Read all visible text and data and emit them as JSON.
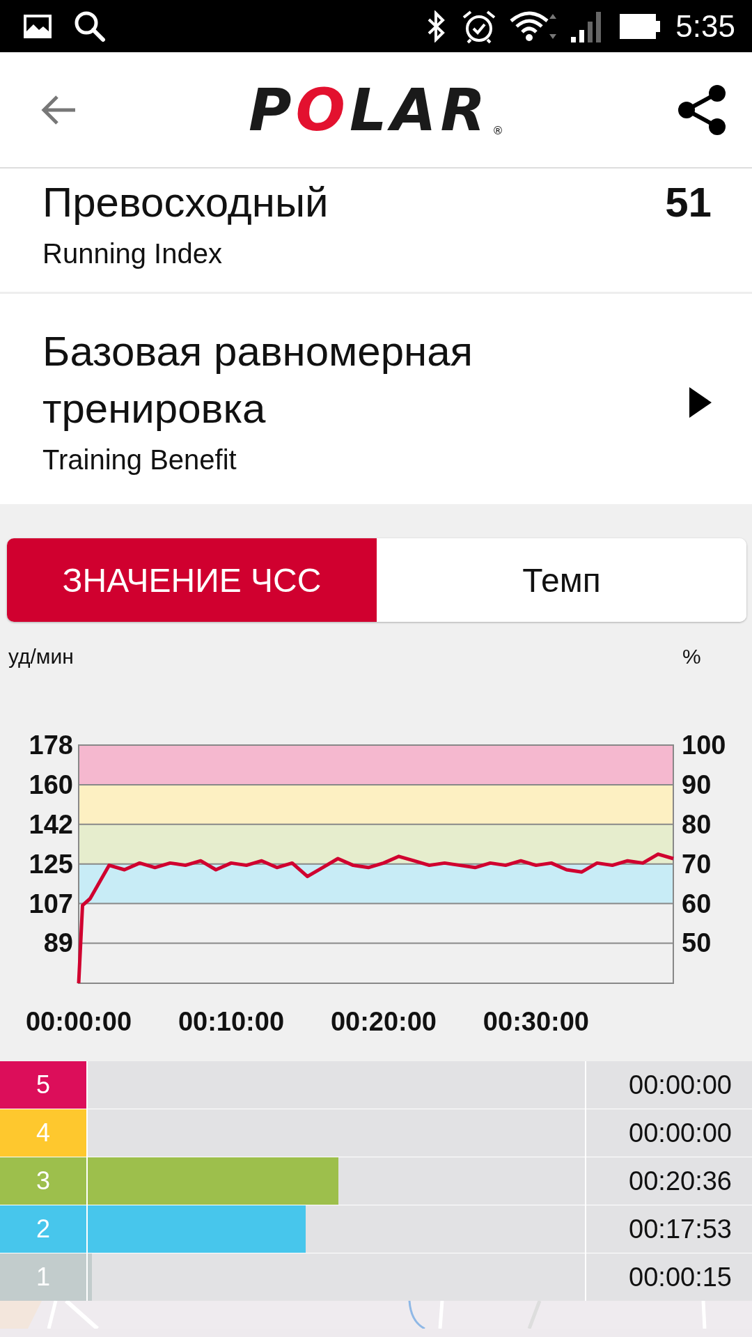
{
  "status_bar": {
    "time": "5:35"
  },
  "app_bar": {
    "logo": "POLAR",
    "logo_mark": "®"
  },
  "running_index": {
    "title": "Превосходный",
    "subtitle": "Running Index",
    "value": "51"
  },
  "training_benefit": {
    "title": "Базовая равномерная тренировка",
    "subtitle": "Training Benefit"
  },
  "tabs": [
    {
      "label": "ЗНАЧЕНИЕ ЧСС",
      "selected": true
    },
    {
      "label": "Темп",
      "selected": false
    }
  ],
  "chart": {
    "right_unit": "%",
    "right_ticks": [
      "100",
      "90",
      "80",
      "70",
      "60",
      "50"
    ],
    "chart_data": {
      "type": "line",
      "ylabel": "уд/мин",
      "xlim": [
        0,
        2340
      ],
      "ylim": [
        71,
        178
      ],
      "xticks": [
        {
          "value": 0,
          "label": "00:00:00"
        },
        {
          "value": 600,
          "label": "00:10:00"
        },
        {
          "value": 1200,
          "label": "00:20:00"
        },
        {
          "value": 1800,
          "label": "00:30:00"
        }
      ],
      "yticks": [
        {
          "value": 89,
          "label": "89"
        },
        {
          "value": 106.8,
          "label": "107"
        },
        {
          "value": 124.6,
          "label": "125"
        },
        {
          "value": 142.4,
          "label": "142"
        },
        {
          "value": 160.2,
          "label": "160"
        },
        {
          "value": 178,
          "label": "178"
        }
      ],
      "grid": true,
      "bands": [
        {
          "axis": "y",
          "from": 160.2,
          "to": 178,
          "color": "#f5b8cf"
        },
        {
          "axis": "y",
          "from": 142.4,
          "to": 160.2,
          "color": "#fdf0c2"
        },
        {
          "axis": "y",
          "from": 124.6,
          "to": 142.4,
          "color": "#e6edcd"
        },
        {
          "axis": "y",
          "from": 106.8,
          "to": 124.6,
          "color": "#c8ecf6"
        }
      ],
      "x": [
        0,
        15,
        45,
        90,
        120,
        180,
        240,
        300,
        360,
        420,
        480,
        540,
        600,
        660,
        720,
        780,
        840,
        900,
        960,
        1020,
        1080,
        1140,
        1200,
        1260,
        1320,
        1380,
        1440,
        1500,
        1560,
        1620,
        1680,
        1740,
        1800,
        1860,
        1920,
        1980,
        2040,
        2100,
        2160,
        2220,
        2280,
        2340
      ],
      "series": [
        {
          "color": "#d0002f",
          "values": [
            71,
            106,
            109,
            118,
            124,
            122,
            125,
            123,
            125,
            124,
            126,
            122,
            125,
            124,
            126,
            123,
            125,
            119,
            123,
            127,
            124,
            123,
            125,
            128,
            126,
            124,
            125,
            124,
            123,
            125,
            124,
            126,
            124,
            125,
            122,
            121,
            125,
            124,
            126,
            125,
            129,
            127
          ]
        }
      ]
    }
  },
  "zones": [
    {
      "zone": "5",
      "color": "#dc0e5a",
      "level": 0,
      "time": "00:00:00"
    },
    {
      "zone": "4",
      "color": "#fec82e",
      "level": 0,
      "time": "00:00:00"
    },
    {
      "zone": "3",
      "color": "#9dbf4c",
      "level": 0.504,
      "time": "00:20:36"
    },
    {
      "zone": "2",
      "color": "#47c6ec",
      "level": 0.438,
      "time": "00:17:53"
    },
    {
      "zone": "1",
      "color": "#c2cccc",
      "level": 0.008,
      "time": "00:00:15"
    }
  ]
}
